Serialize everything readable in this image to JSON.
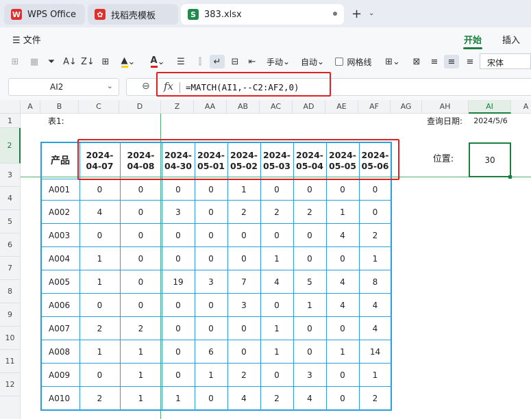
{
  "tabs": [
    {
      "label": "WPS Office",
      "icon": "wps-logo-icon"
    },
    {
      "label": "找稻壳模板",
      "icon": "daoke-logo-icon"
    },
    {
      "label": "383.xlsx",
      "icon": "spreadsheet-icon"
    }
  ],
  "menu": {
    "file": "文件",
    "tabs": [
      "开始",
      "插入"
    ],
    "active": "开始"
  },
  "toolbar": {
    "wrap_label": "手动",
    "autofit_label": "自动",
    "gridlines_label": "网格线",
    "font_name": "宋体"
  },
  "formula_bar": {
    "cell_ref": "AI2",
    "formula": "=MATCH(AI1,--C2:AF2,0)"
  },
  "grid": {
    "columns": [
      "A",
      "B",
      "C",
      "D",
      "Z",
      "AA",
      "AB",
      "AC",
      "AD",
      "AE",
      "AF",
      "AG",
      "AH",
      "AI",
      "A"
    ],
    "selected_column": "AI",
    "rows": [
      "1",
      "2",
      "3",
      "4",
      "5",
      "6",
      "7",
      "8",
      "9",
      "10",
      "11",
      "12"
    ],
    "selected_row": "2",
    "table_label": "表1:",
    "query_date_label": "查询日期:",
    "query_date_value": "2024/5/6",
    "position_label": "位置:",
    "position_value": "30",
    "product_header": "产品",
    "date_headers": [
      "2024-\n04-07",
      "2024-\n04-08",
      "2024-\n04-30",
      "2024-\n05-01",
      "2024-\n05-02",
      "2024-\n05-03",
      "2024-\n05-04",
      "2024-\n05-05",
      "2024-\n05-06"
    ],
    "products": [
      "A001",
      "A002",
      "A003",
      "A004",
      "A005",
      "A006",
      "A007",
      "A008",
      "A009",
      "A010"
    ],
    "values": [
      [
        "0",
        "0",
        "0",
        "0",
        "1",
        "0",
        "0",
        "0",
        "0"
      ],
      [
        "4",
        "0",
        "3",
        "0",
        "2",
        "2",
        "2",
        "1",
        "0"
      ],
      [
        "0",
        "0",
        "0",
        "0",
        "0",
        "0",
        "0",
        "4",
        "2"
      ],
      [
        "1",
        "0",
        "0",
        "0",
        "0",
        "1",
        "0",
        "0",
        "1"
      ],
      [
        "1",
        "0",
        "19",
        "3",
        "7",
        "4",
        "5",
        "4",
        "8"
      ],
      [
        "0",
        "0",
        "0",
        "0",
        "3",
        "0",
        "1",
        "4",
        "4"
      ],
      [
        "2",
        "2",
        "0",
        "0",
        "0",
        "1",
        "0",
        "0",
        "4"
      ],
      [
        "1",
        "1",
        "0",
        "6",
        "0",
        "1",
        "0",
        "1",
        "14"
      ],
      [
        "0",
        "1",
        "0",
        "1",
        "2",
        "0",
        "3",
        "0",
        "1"
      ],
      [
        "2",
        "1",
        "1",
        "0",
        "4",
        "2",
        "4",
        "0",
        "2"
      ]
    ]
  }
}
